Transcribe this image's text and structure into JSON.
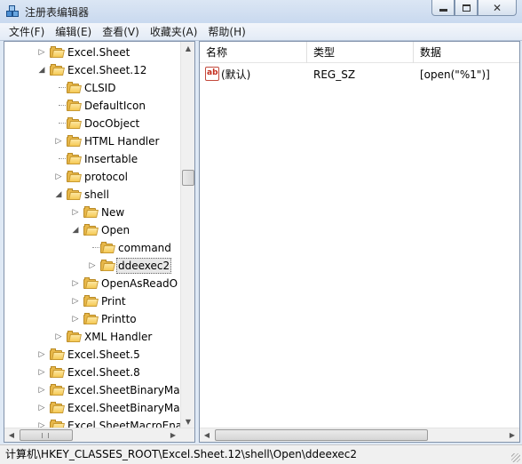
{
  "window": {
    "title": "注册表编辑器",
    "buttons": {
      "minimize": "minimize",
      "maximize": "maximize",
      "close": "close"
    }
  },
  "menu": [
    "文件(F)",
    "编辑(E)",
    "查看(V)",
    "收藏夹(A)",
    "帮助(H)"
  ],
  "tree": {
    "rows": [
      {
        "label": "Excel.Sheet",
        "level": 0,
        "expander": "collapsed"
      },
      {
        "label": "Excel.Sheet.12",
        "level": 0,
        "expander": "expanded"
      },
      {
        "label": "CLSID",
        "level": 1,
        "expander": "none"
      },
      {
        "label": "DefaultIcon",
        "level": 1,
        "expander": "none"
      },
      {
        "label": "DocObject",
        "level": 1,
        "expander": "none"
      },
      {
        "label": "HTML Handler",
        "level": 1,
        "expander": "collapsed"
      },
      {
        "label": "Insertable",
        "level": 1,
        "expander": "none"
      },
      {
        "label": "protocol",
        "level": 1,
        "expander": "collapsed"
      },
      {
        "label": "shell",
        "level": 1,
        "expander": "expanded"
      },
      {
        "label": "New",
        "level": 2,
        "expander": "collapsed"
      },
      {
        "label": "Open",
        "level": 2,
        "expander": "expanded"
      },
      {
        "label": "command",
        "level": 3,
        "expander": "none"
      },
      {
        "label": "ddeexec2",
        "level": 3,
        "expander": "collapsed",
        "selected": true
      },
      {
        "label": "OpenAsReadO",
        "level": 2,
        "expander": "collapsed"
      },
      {
        "label": "Print",
        "level": 2,
        "expander": "collapsed"
      },
      {
        "label": "Printto",
        "level": 2,
        "expander": "collapsed"
      },
      {
        "label": "XML Handler",
        "level": 1,
        "expander": "collapsed"
      },
      {
        "label": "Excel.Sheet.5",
        "level": 0,
        "expander": "collapsed"
      },
      {
        "label": "Excel.Sheet.8",
        "level": 0,
        "expander": "collapsed"
      },
      {
        "label": "Excel.SheetBinaryMac",
        "level": 0,
        "expander": "collapsed"
      },
      {
        "label": "Excel.SheetBinaryMac",
        "level": 0,
        "expander": "collapsed"
      },
      {
        "label": "Excel.SheetMacroEna",
        "level": 0,
        "expander": "collapsed"
      }
    ],
    "scroll_position": 0.33
  },
  "values": {
    "headers": [
      "名称",
      "类型",
      "数据"
    ],
    "rows": [
      {
        "icon": "string-value-icon",
        "icon_text": "ab",
        "name": "(默认)",
        "type": "REG_SZ",
        "data": "[open(\"%1\")]"
      }
    ]
  },
  "statusbar": {
    "path": "计算机\\HKEY_CLASSES_ROOT\\Excel.Sheet.12\\shell\\Open\\ddeexec2"
  },
  "colors": {
    "folder": "#e7b749",
    "window_frame": "#dfe9f5",
    "selection": "#e8e8e8"
  }
}
